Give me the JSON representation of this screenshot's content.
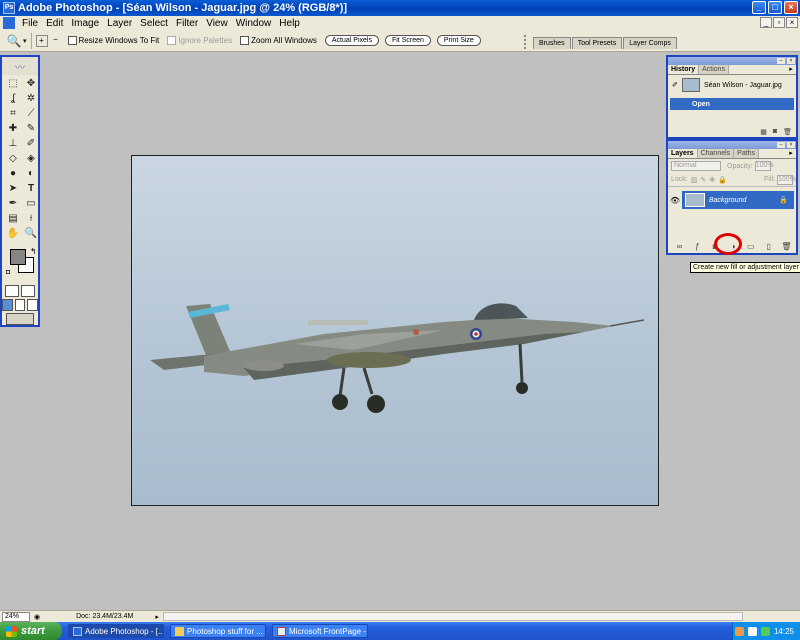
{
  "window": {
    "title": "Adobe Photoshop - [Séan Wilson - Jaguar.jpg @ 24% (RGB/8*)]",
    "app_icon": "Ps",
    "controls": [
      "minimize",
      "maximize",
      "close"
    ]
  },
  "menubar": {
    "items": [
      "File",
      "Edit",
      "Image",
      "Layer",
      "Select",
      "Filter",
      "View",
      "Window",
      "Help"
    ]
  },
  "options_bar": {
    "tool_icon": "zoom-tool-icon",
    "checkboxes": [
      {
        "label": "Resize Windows To Fit",
        "checked": false,
        "disabled": false
      },
      {
        "label": "Ignore Palettes",
        "checked": false,
        "disabled": true
      },
      {
        "label": "Zoom All Windows",
        "checked": false,
        "disabled": false
      }
    ],
    "buttons": [
      "Actual Pixels",
      "Fit Screen",
      "Print Size"
    ]
  },
  "palette_well": {
    "tabs": [
      "Brushes",
      "Tool Presets",
      "Layer Comps"
    ]
  },
  "toolbox": {
    "foreground_color": "#858585",
    "background_color": "#ffffff"
  },
  "history_palette": {
    "tabs": [
      "History",
      "Actions"
    ],
    "active_tab": "History",
    "snapshot": "Séan Wilson - Jaguar.jpg",
    "states": [
      "Open"
    ]
  },
  "layers_palette": {
    "tabs": [
      "Layers",
      "Channels",
      "Paths"
    ],
    "active_tab": "Layers",
    "blend_mode": "Normal",
    "opacity_label": "Opacity:",
    "opacity": "100%",
    "lock_label": "Lock:",
    "fill_label": "Fill:",
    "fill": "100%",
    "layers": [
      {
        "name": "Background",
        "visible": true,
        "locked": true,
        "selected": true
      }
    ]
  },
  "tooltip": "Create new fill or adjustment layer",
  "statusbar": {
    "zoom": "24%",
    "doc_info": "Doc: 23.4M/23.4M"
  },
  "taskbar": {
    "start_label": "start",
    "tasks": [
      {
        "label": "Adobe Photoshop - [...",
        "active": true
      },
      {
        "label": "Photoshop stuff for ...",
        "active": false
      },
      {
        "label": "Microsoft FrontPage - ...",
        "active": false
      }
    ],
    "clock": "14:25"
  },
  "colors": {
    "selection": "#316ac5",
    "palette_border": "#1e44c0",
    "highlight_ring": "#e00000",
    "workspace": "#c0c0c0"
  }
}
